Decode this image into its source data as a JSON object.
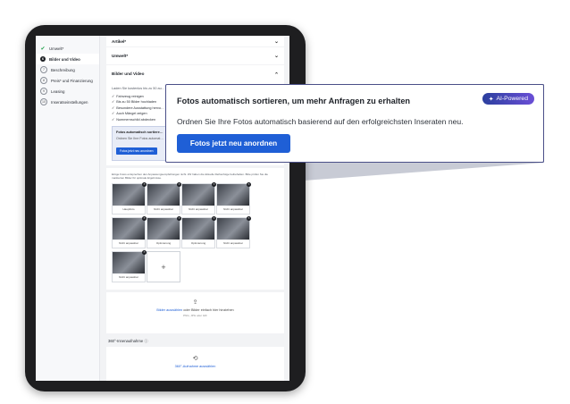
{
  "sidebar": {
    "items": [
      {
        "label": "Umwelt*",
        "marker": "✔",
        "state": "done"
      },
      {
        "label": "Bilder und Video",
        "marker": "6",
        "state": "active"
      },
      {
        "label": "Beschreibung",
        "marker": "7",
        "state": "todo"
      },
      {
        "label": "Preis* und Finanzierung",
        "marker": "8",
        "state": "todo"
      },
      {
        "label": "Leasing",
        "marker": "9",
        "state": "todo"
      },
      {
        "label": "Inseratseinstellungen",
        "marker": "10",
        "state": "todo"
      }
    ]
  },
  "sections": {
    "artikel": "Artikel*",
    "umwelt": "Umwelt*",
    "bilder": "Bilder und Video"
  },
  "bilder_card": {
    "intro": "Laden Sie kostenlos bis zu 50 au… besser! Ziehen Sie die gewünscht…",
    "checks": [
      "Fahrzeug reinigen",
      "Bis zu 50 Bilder hochladen",
      "Besondere Ausstattung hervo…",
      "Auch Mängel zeigen",
      "Nummernschild abdecken"
    ],
    "mini_title": "Fotos automatisch sortiere…",
    "mini_desc": "Ordnen Sie Ihre Fotos automat…",
    "mini_button": "Fotos jetzt neu anordnen"
  },
  "photos_card": {
    "note": "Einige Fotos entsprechen den Anpassungsempfehlungen nicht. Wir haben die Aktuelle Reihenfolge beibehalten. Bitte prüfen Sie die markierten Bilder für optimale Ergebnisse.",
    "tiles": [
      {
        "caption": "Hauptfoto"
      },
      {
        "caption": "Nicht anpassbar"
      },
      {
        "caption": "Nicht anpassbar"
      },
      {
        "caption": "Nicht anpassbar"
      },
      {
        "caption": "Nicht anpassbar"
      },
      {
        "caption": "Optimierung"
      },
      {
        "caption": "Optimierung"
      },
      {
        "caption": "Nicht anpassbar"
      },
      {
        "caption": "Nicht anpassbar"
      }
    ],
    "add_symbol": "+"
  },
  "upload": {
    "link": "Bilder auswählen",
    "text": " oder Bilder einfach hier hinziehen",
    "hint": "PNG, JPG oder GIF"
  },
  "rotation": {
    "heading": "360°-Innenaufnahme ⓘ",
    "link": "360°-Aufnahme auswählen"
  },
  "popup": {
    "title": "Fotos automatisch sortieren, um mehr Anfragen zu erhalten",
    "badge": "AI-Powered",
    "badge_icon": "✦",
    "description": "Ordnen Sie Ihre Fotos automatisch basierend auf den erfolgreichsten Inseraten neu.",
    "button": "Fotos jetzt neu anordnen"
  },
  "icons": {
    "chevron": "⌄",
    "upload": "⇪",
    "rotate": "⟲",
    "check": "✓"
  },
  "colors": {
    "accent": "#1f5fd6",
    "badge_start": "#2b3f9e",
    "badge_end": "#6a4fd6",
    "done": "#23a24d"
  }
}
